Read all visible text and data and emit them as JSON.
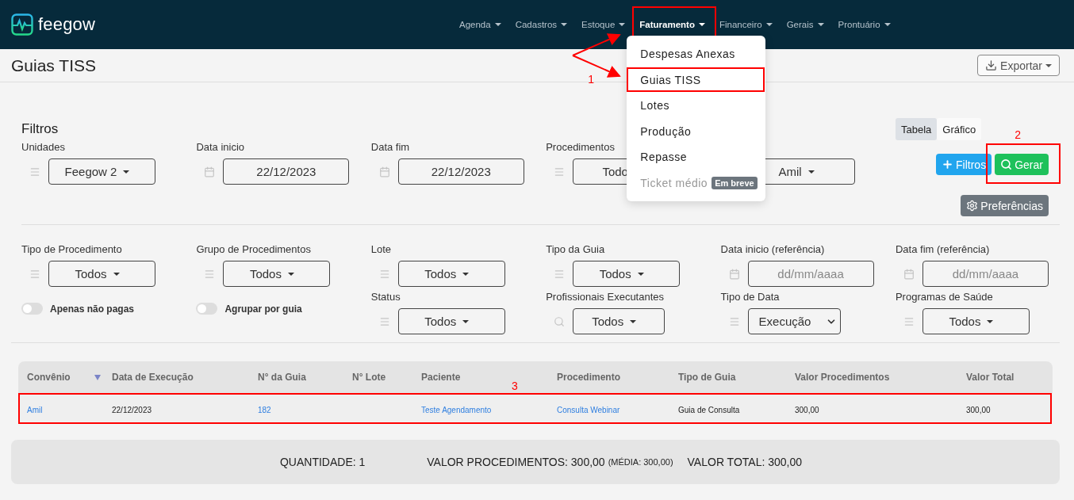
{
  "brand": {
    "name": "feegow"
  },
  "nav": [
    {
      "label": "Agenda",
      "active": false,
      "highlighted": false
    },
    {
      "label": "Cadastros",
      "active": false,
      "highlighted": false
    },
    {
      "label": "Estoque",
      "active": false,
      "highlighted": false
    },
    {
      "label": "Faturamento",
      "active": true,
      "highlighted": true
    },
    {
      "label": "Financeiro",
      "active": false,
      "highlighted": false
    },
    {
      "label": "Gerais",
      "active": false,
      "highlighted": false
    },
    {
      "label": "Prontuário",
      "active": false,
      "highlighted": false
    }
  ],
  "nav_menu": {
    "items": [
      {
        "label": "Despesas Anexas",
        "disabled": false,
        "highlighted": false
      },
      {
        "label": "Guias TISS",
        "disabled": false,
        "highlighted": true,
        "callout": "1"
      },
      {
        "label": "Lotes",
        "disabled": false,
        "highlighted": false
      },
      {
        "label": "Produção",
        "disabled": false,
        "highlighted": false
      },
      {
        "label": "Repasse",
        "disabled": false,
        "highlighted": false
      },
      {
        "label": "Ticket médio",
        "disabled": true,
        "highlighted": false,
        "badge": "Em breve"
      }
    ]
  },
  "page": {
    "title": "Guias TISS",
    "export_button": "Exportar"
  },
  "filters": {
    "title": "Filtros",
    "view_tabs": [
      {
        "label": "Tabela",
        "selected": true
      },
      {
        "label": "Gráfico",
        "selected": false
      }
    ],
    "main": [
      {
        "kind": "dropdown",
        "label": "Unidades",
        "value": "Feegow 2"
      },
      {
        "kind": "date",
        "label": "Data inicio",
        "value": "22/12/2023"
      },
      {
        "kind": "date",
        "label": "Data fim",
        "value": "22/12/2023"
      },
      {
        "kind": "dropdown",
        "label": "Procedimentos",
        "value": "Todo"
      },
      {
        "kind": "dropdown",
        "value": "Amil"
      }
    ],
    "filters_button": "Filtros",
    "generate_button": {
      "label": "Gerar",
      "highlighted": true,
      "callout": "2"
    },
    "preferences_button": "Preferências",
    "more": [
      {
        "items": [
          {
            "kind": "dropdown",
            "label": "Tipo de Procedimento",
            "value": "Todos"
          },
          {
            "kind": "toggle",
            "label": "Apenas não pagas",
            "on": false
          }
        ]
      },
      {
        "items": [
          {
            "kind": "dropdown",
            "label": "Grupo de Procedimentos",
            "value": "Todos"
          },
          {
            "kind": "toggle",
            "label": "Agrupar por guia",
            "on": false
          }
        ]
      },
      {
        "items": [
          {
            "kind": "dropdown",
            "label": "Lote",
            "value": "Todos"
          },
          {
            "kind": "dropdown",
            "label": "Status",
            "value": "Todos"
          }
        ]
      },
      {
        "items": [
          {
            "kind": "dropdown",
            "label": "Tipo da Guia",
            "value": "Todos"
          },
          {
            "kind": "dropdown",
            "label": "Profissionais Executantes",
            "value": "Todos",
            "searchable": true
          }
        ]
      },
      {
        "items": [
          {
            "kind": "date",
            "label": "Data inicio (referência)",
            "placeholder": "dd/mm/aaaa"
          },
          {
            "kind": "select",
            "label": "Tipo de Data",
            "value": "Execução"
          }
        ]
      },
      {
        "items": [
          {
            "kind": "date",
            "label": "Data fim (referência)",
            "placeholder": "dd/mm/aaaa"
          },
          {
            "kind": "dropdown",
            "label": "Programas de Saúde",
            "value": "Todos"
          }
        ]
      }
    ]
  },
  "table": {
    "columns": [
      {
        "label": "Convênio",
        "sorted": true
      },
      {
        "label": "Data de Execução",
        "sorted": false
      },
      {
        "label": "N° da Guia",
        "sorted": false
      },
      {
        "label": "N° Lote",
        "sorted": false
      },
      {
        "label": "Paciente",
        "sorted": false
      },
      {
        "label": "Procedimento",
        "sorted": false
      },
      {
        "label": "Tipo de Guia",
        "sorted": false
      },
      {
        "label": "Valor Procedimentos",
        "sorted": false
      },
      {
        "label": "Valor Total",
        "sorted": false
      }
    ],
    "rows": [
      {
        "highlighted": true,
        "callout": "3",
        "cells": [
          {
            "text": "Amil",
            "link": true
          },
          {
            "text": "22/12/2023",
            "link": false
          },
          {
            "text": "182",
            "link": true
          },
          {},
          {
            "text": "Teste Agendamento",
            "link": true
          },
          {
            "text": "Consulta Webinar",
            "link": true
          },
          {
            "text": "Guia de Consulta",
            "link": false
          },
          {
            "text": "300,00",
            "link": false
          },
          {
            "text": "300,00",
            "link": false
          }
        ]
      }
    ]
  },
  "summary": [
    {
      "text": "QUANTIDADE: 1"
    },
    {
      "text": "VALOR PROCEDIMENTOS: 300,00",
      "note": "(MÉDIA: 300,00)"
    },
    {
      "text": "VALOR TOTAL: 300,00"
    }
  ]
}
